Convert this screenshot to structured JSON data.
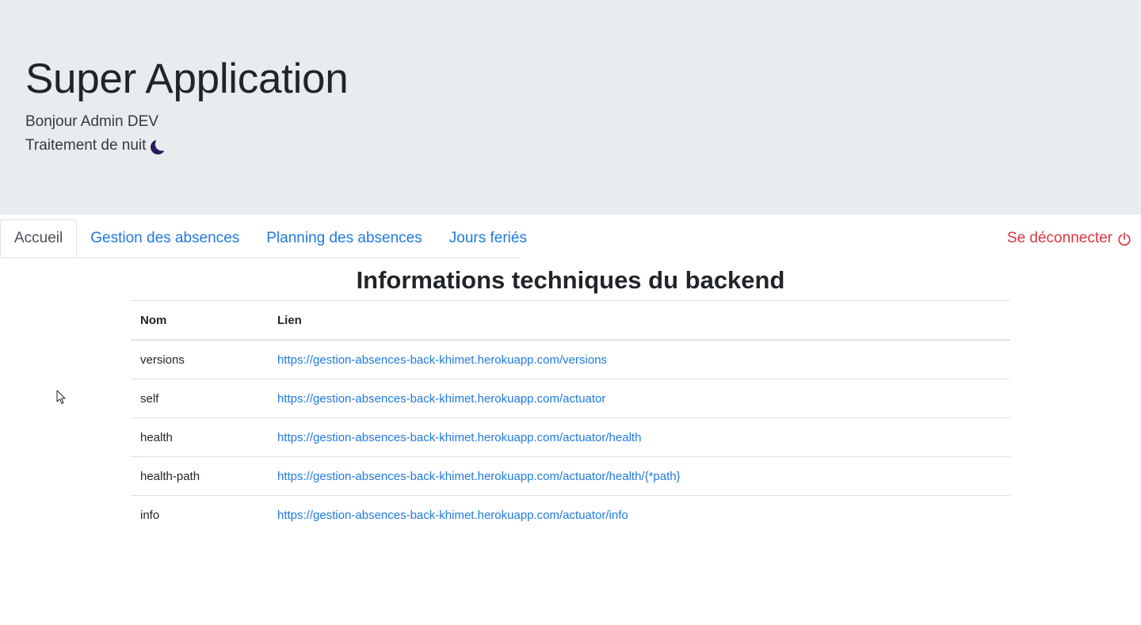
{
  "header": {
    "title": "Super Application",
    "greeting": "Bonjour Admin DEV",
    "night_label": "Traitement de nuit",
    "night_icon": "moon-icon",
    "background": "#e9ecef"
  },
  "tabs": [
    {
      "label": "Accueil",
      "active": true
    },
    {
      "label": "Gestion des absences",
      "active": false
    },
    {
      "label": "Planning des absences",
      "active": false
    },
    {
      "label": "Jours feriés",
      "active": false
    }
  ],
  "logout": {
    "label": "Se déconnecter",
    "icon": "power-icon",
    "color": "#dc3545"
  },
  "main": {
    "title": "Informations techniques du backend",
    "table": {
      "headers": [
        "Nom",
        "Lien"
      ],
      "rows": [
        {
          "name": "versions",
          "link": "https://gestion-absences-back-khimet.herokuapp.com/versions"
        },
        {
          "name": "self",
          "link": "https://gestion-absences-back-khimet.herokuapp.com/actuator"
        },
        {
          "name": "health",
          "link": "https://gestion-absences-back-khimet.herokuapp.com/actuator/health"
        },
        {
          "name": "health-path",
          "link": "https://gestion-absences-back-khimet.herokuapp.com/actuator/health/{*path}"
        },
        {
          "name": "info",
          "link": "https://gestion-absences-back-khimet.herokuapp.com/actuator/info"
        }
      ]
    }
  },
  "colors": {
    "link": "#1f7ae0",
    "text": "#212529"
  }
}
